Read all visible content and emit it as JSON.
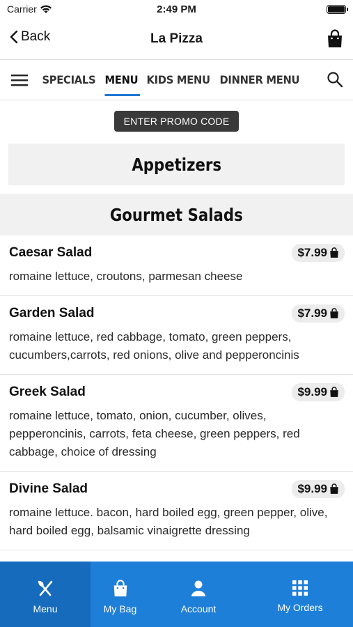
{
  "status_bar": {
    "carrier": "Carrier",
    "time": "2:49 PM"
  },
  "nav": {
    "back_label": "Back",
    "title": "La Pizza"
  },
  "tabs": [
    {
      "label": "SPECIALS",
      "active": false
    },
    {
      "label": "MENU",
      "active": true
    },
    {
      "label": "KIDS MENU",
      "active": false
    },
    {
      "label": "DINNER MENU",
      "active": false
    }
  ],
  "promo": {
    "label": "ENTER PROMO CODE"
  },
  "categories": {
    "appetizers": "Appetizers",
    "salads": "Gourmet Salads"
  },
  "items": [
    {
      "name": "Caesar Salad",
      "price": "$7.99",
      "desc": "romaine lettuce, croutons, parmesan cheese"
    },
    {
      "name": "Garden Salad",
      "price": "$7.99",
      "desc": "romaine lettuce, red cabbage, tomato, green peppers, cucumbers,carrots, red onions, olive and pepperoncinis"
    },
    {
      "name": "Greek Salad",
      "price": "$9.99",
      "desc": "romaine lettuce, tomato, onion, cucumber, olives, pepperoncinis, carrots, feta cheese, green peppers, red cabbage, choice of dressing"
    },
    {
      "name": "Divine Salad",
      "price": "$9.99",
      "desc": "romaine lettuce. bacon, hard boiled egg, green pepper, olive, hard boiled egg, balsamic vinaigrette dressing"
    }
  ],
  "bottom_nav": [
    {
      "label": "Menu",
      "icon": "utensils-icon",
      "active": true
    },
    {
      "label": "My Bag",
      "icon": "bag-icon",
      "active": false
    },
    {
      "label": "Account",
      "icon": "person-icon",
      "active": false
    },
    {
      "label": "My Orders",
      "icon": "grid-icon",
      "active": false
    }
  ],
  "colors": {
    "accent": "#1e78d3",
    "bottom_bar": "#1e7fd8",
    "promo_bg": "#3a3a3a"
  }
}
